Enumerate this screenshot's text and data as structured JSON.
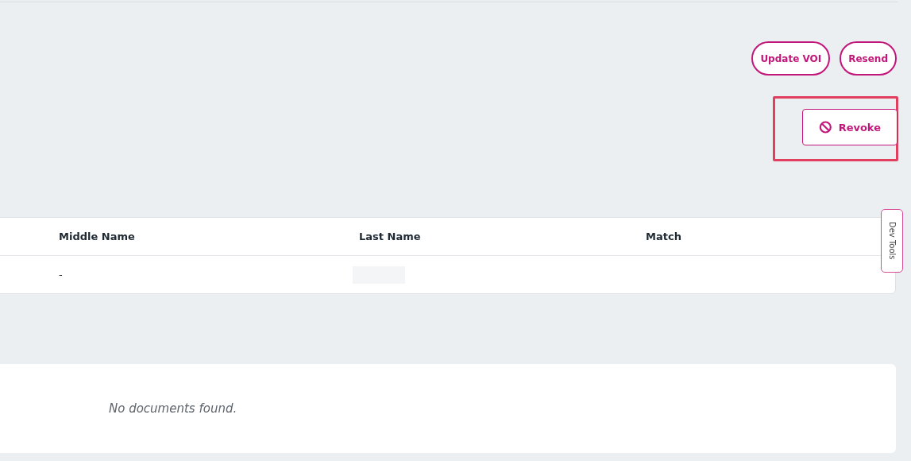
{
  "actions": [
    {
      "label": "Update VOI"
    },
    {
      "label": "Resend"
    }
  ],
  "revoke": {
    "label": "Revoke",
    "highlighted": true
  },
  "table": {
    "columns": [
      "Middle Name",
      "Last Name",
      "Match"
    ],
    "rows": [
      [
        {
          "text": "-"
        },
        {
          "redacted": true
        },
        {
          "text": ""
        }
      ]
    ]
  },
  "dev_tools": {
    "label": "Dev Tools"
  },
  "documents": {
    "empty_message": "No documents found."
  }
}
